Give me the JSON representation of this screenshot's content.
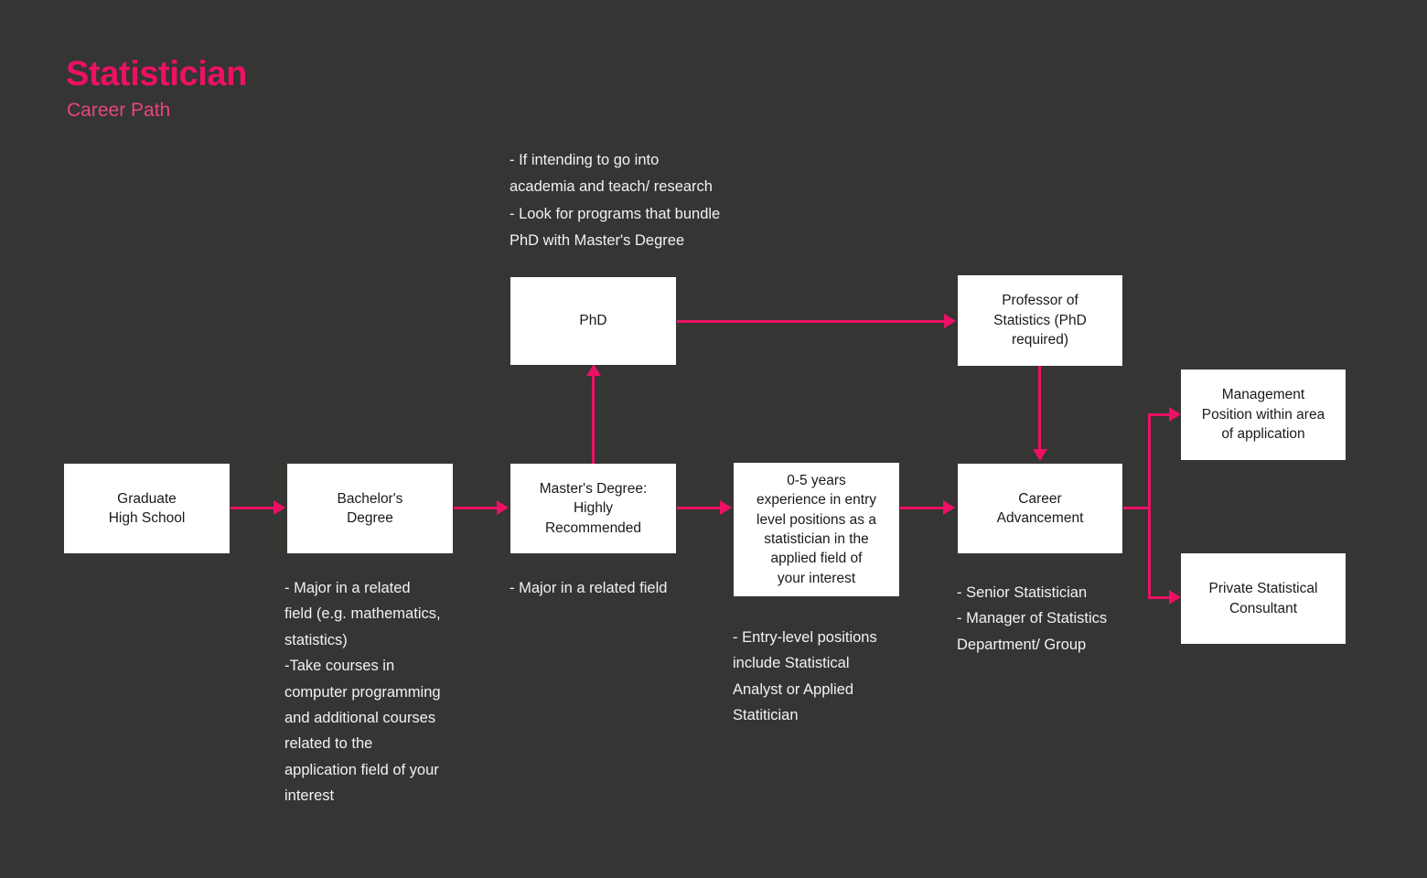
{
  "page": {
    "background_color": "#353533",
    "accent_color": "#EC1164",
    "node_fill": "#FFFFFF",
    "text_color": "#F2F2F2"
  },
  "header": {
    "title": "Statistician",
    "subtitle": "Career Path"
  },
  "nodes": {
    "graduate_high_school": "Graduate\nHigh School",
    "bachelors_degree": "Bachelor's\nDegree",
    "masters_degree": "Master's Degree:\nHighly\nRecommended",
    "phd": "PhD",
    "experience": "0-5 years\nexperience in entry\nlevel positions as a\nstatistician in the\napplied field of\nyour interest",
    "professor": "Professor of\nStatistics (PhD\nrequired)",
    "career_advancement": "Career\nAdvancement",
    "management_position": "Management\nPosition within area\nof application",
    "private_consultant": "Private Statistical\nConsultant"
  },
  "notes": {
    "phd_note": "- If intending to go into\nacademia and teach/ research\n- Look for programs that bundle\nPhD with Master's Degree",
    "bachelors_note": "- Major in a related\nfield (e.g. mathematics,\nstatistics)\n-Take courses in\ncomputer programming\nand additional courses\nrelated to the\napplication field of your\ninterest",
    "masters_note": "- Major in a related field",
    "experience_note": "- Entry-level positions\ninclude Statistical\nAnalyst or Applied\nStatitician",
    "career_note": "- Senior Statistician\n- Manager of Statistics\nDepartment/ Group"
  }
}
